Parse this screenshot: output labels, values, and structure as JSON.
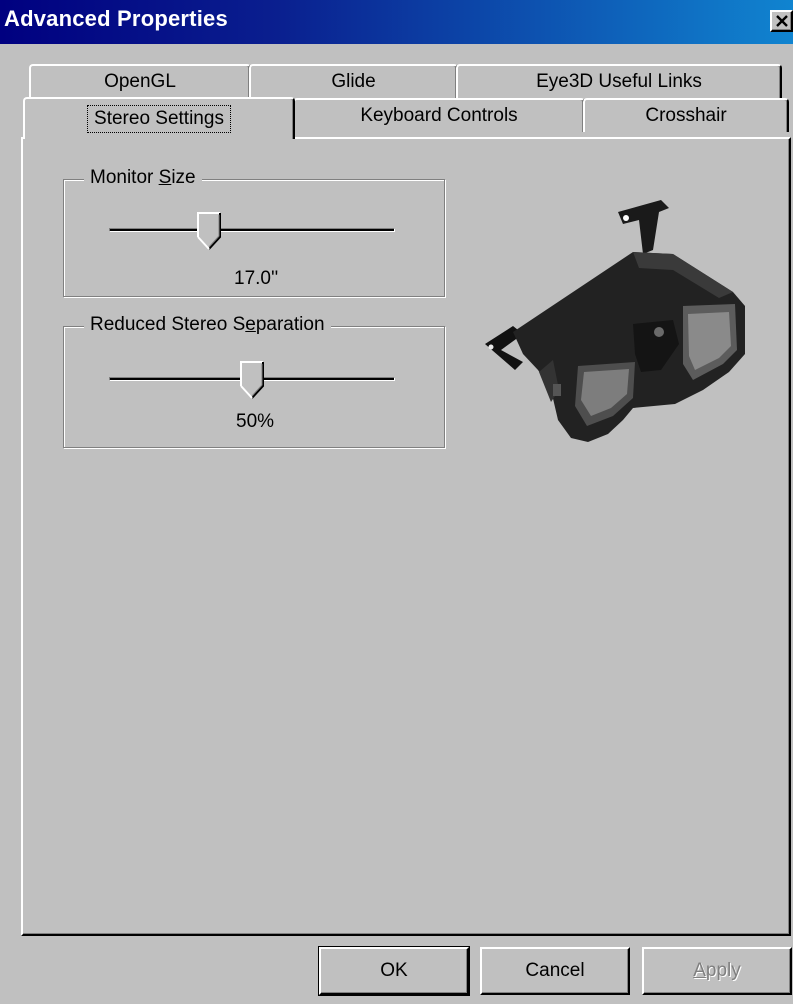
{
  "window": {
    "title": "Advanced Properties"
  },
  "tabs": {
    "row1": [
      {
        "label": "OpenGL"
      },
      {
        "label": "Glide"
      },
      {
        "label": "Eye3D Useful Links"
      }
    ],
    "row2": [
      {
        "label": "Stereo Settings",
        "active": true
      },
      {
        "label": "Keyboard Controls"
      },
      {
        "label": "Crosshair"
      }
    ]
  },
  "monitor_size": {
    "legend_pre": "Monitor ",
    "legend_accel": "S",
    "legend_post": "ize",
    "value": "17.0''",
    "slider_fraction": 0.35
  },
  "stereo_separation": {
    "legend_pre": "Reduced Stereo S",
    "legend_accel": "e",
    "legend_post": "paration",
    "value": "50%",
    "slider_fraction": 0.5
  },
  "buttons": {
    "ok": "OK",
    "cancel": "Cancel",
    "apply_accel": "A",
    "apply_rest": "pply"
  },
  "colors": {
    "face": "#c0c0c0",
    "titlebar_start": "#000080",
    "titlebar_end": "#1084d0",
    "disabled_text": "#808080"
  },
  "icons": {
    "close": "close-icon",
    "image": "stereo-glasses-image"
  }
}
